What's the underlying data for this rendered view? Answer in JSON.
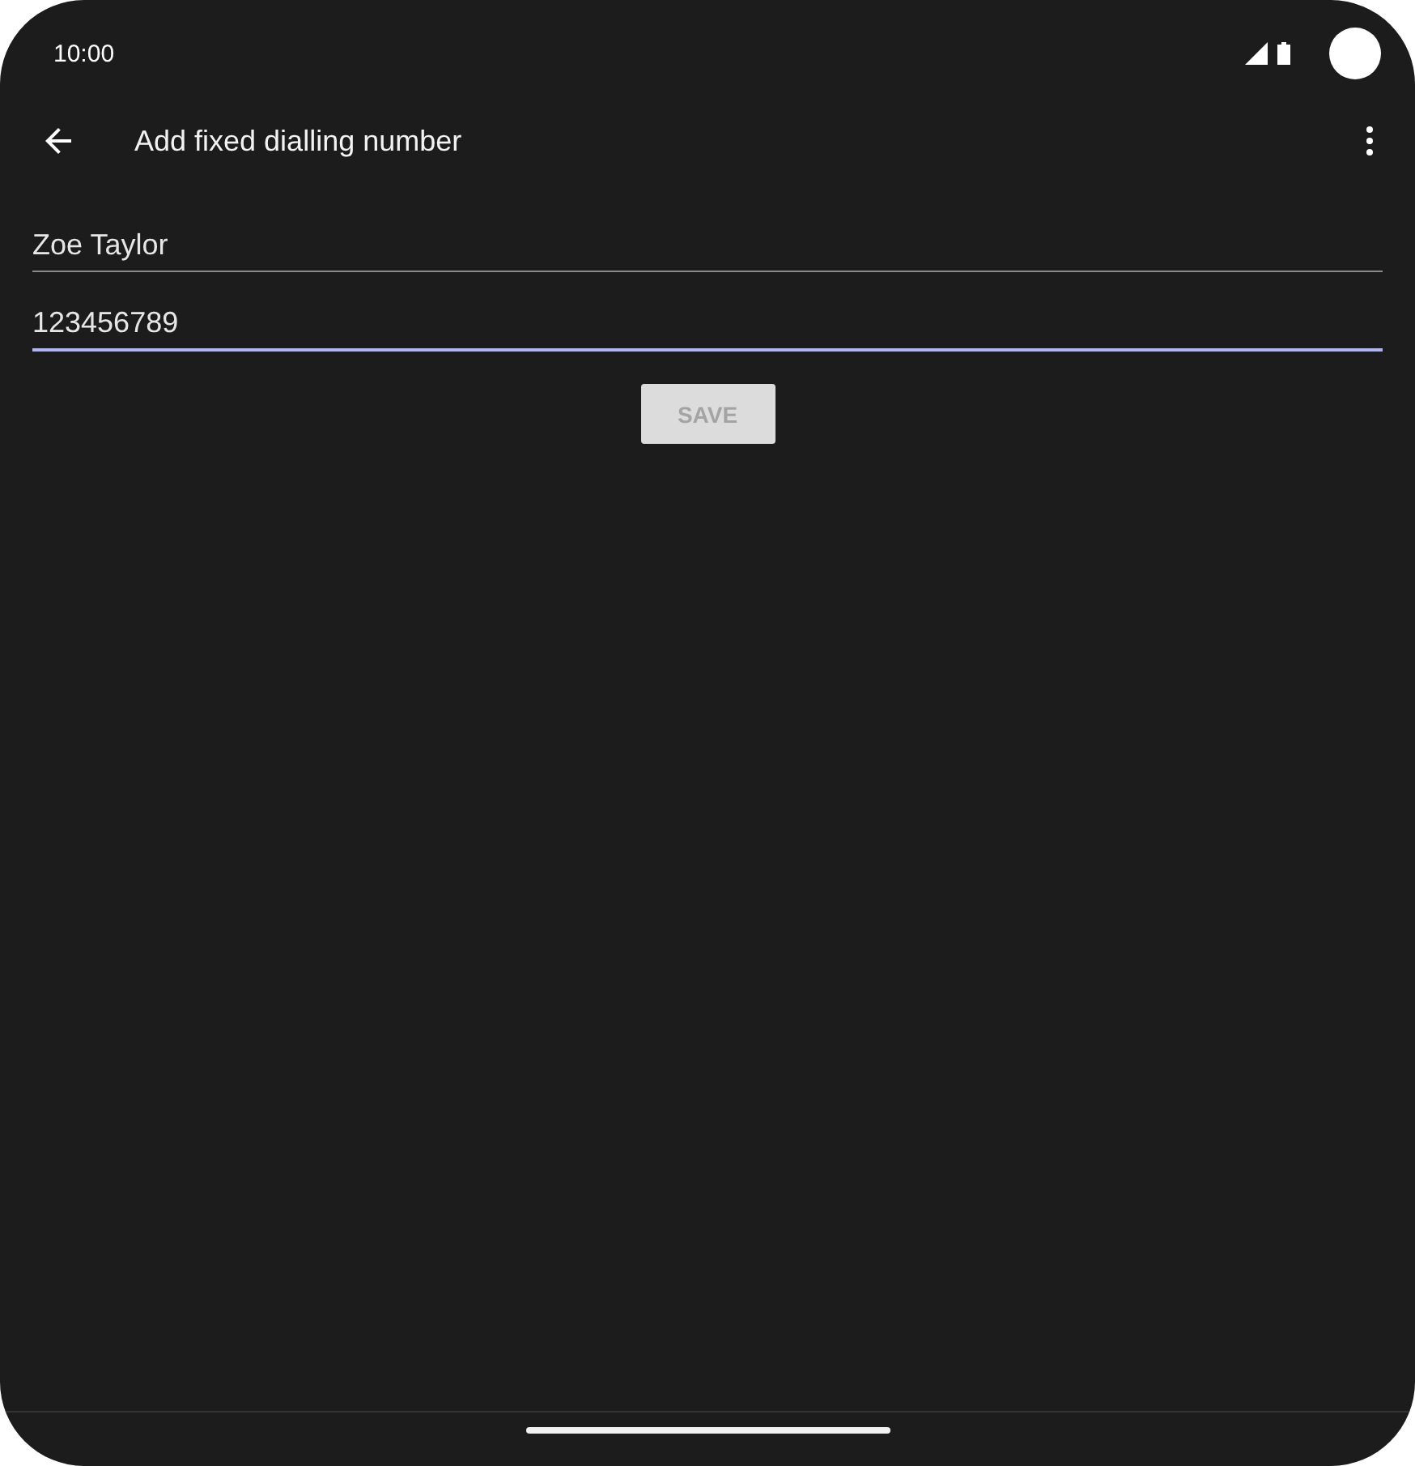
{
  "status_bar": {
    "time": "10:00"
  },
  "toolbar": {
    "title": "Add fixed dialling number"
  },
  "fields": [
    {
      "value": "Zoe Taylor",
      "focused": false
    },
    {
      "value": "123456789",
      "focused": true
    }
  ],
  "save_button": {
    "label": "SAVE",
    "disabled": true
  }
}
